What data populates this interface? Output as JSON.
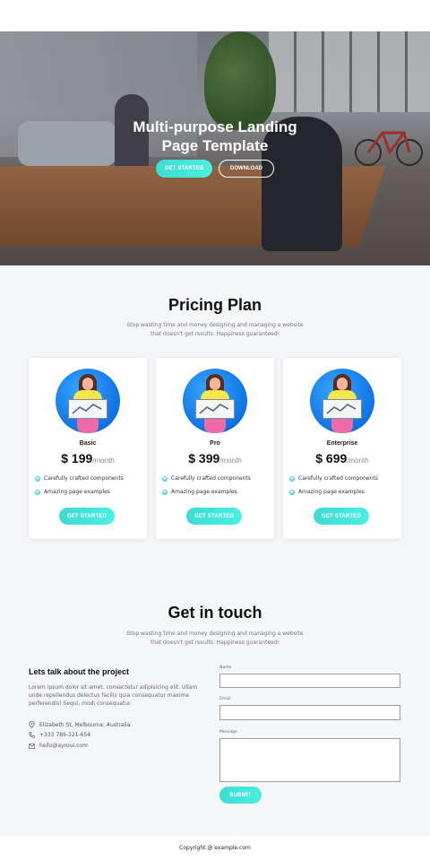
{
  "hero": {
    "title_line1": "Multi-purpose Landing",
    "title_line2": "Page Template",
    "primary_button": "GET STARTED",
    "secondary_button": "DOWNLOAD"
  },
  "pricing": {
    "title": "Pricing Plan",
    "subtitle_line1": "Stop wasting time and money designing and managing a website",
    "subtitle_line2": "that doesn't get results. Happiness guaranteed!",
    "plans": [
      {
        "name": "Basic",
        "price": "$ 199",
        "period": "/month",
        "features": [
          "Carefully crafted components",
          "Amazing page examples"
        ],
        "button": "GET STARTED"
      },
      {
        "name": "Pro",
        "price": "$ 399",
        "period": "/month",
        "features": [
          "Carefully crafted components",
          "Amazing page examples"
        ],
        "button": "GET STARTED"
      },
      {
        "name": "Enterprise",
        "price": "$ 699",
        "period": "/month",
        "features": [
          "Carefully crafted components",
          "Amazing page examples"
        ],
        "button": "GET STARTED"
      }
    ]
  },
  "contact": {
    "title": "Get in touch",
    "subtitle_line1": "Stop wasting time and money designing and managing a website",
    "subtitle_line2": "that doesn't get results. Happiness guaranteed!",
    "heading": "Lets talk about the project",
    "body": "Lorem ipsum dolor sit amet, consectetur adipisicing elit. Ullam unde repellendus delectus facilis quia consequatur maxime perferendis! Sequi, modi consequatur.",
    "address": "Elizabeth St, Melbourne, Australia",
    "phone": "+333 789-321-654",
    "email": "hello@ayroui.com",
    "form": {
      "name_label": "Name",
      "email_label": "Email",
      "message_label": "Message",
      "submit": "SUBMIT"
    }
  },
  "footer": {
    "copyright": "Copyright @ example.com"
  },
  "colors": {
    "accent": "#3ddbd1",
    "illustration_bg": "#1f86f0"
  }
}
